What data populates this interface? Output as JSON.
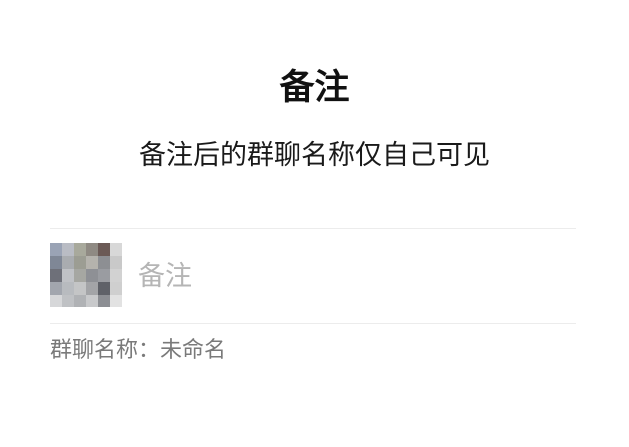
{
  "dialog": {
    "title": "备注",
    "subtitle": "备注后的群聊名称仅自己可见"
  },
  "remark_field": {
    "placeholder": "备注",
    "value": ""
  },
  "group_name": {
    "label": "群聊名称：",
    "value": "未命名"
  },
  "avatar": {
    "description_icon": "group-avatar-pixelated",
    "palette": [
      "#9aa3b5",
      "#b9bcc4",
      "#a8a99c",
      "#8f8a83",
      "#6b5a56",
      "#d8d8d8",
      "#7f8796",
      "#a9acb0",
      "#9c9d93",
      "#b5b3ad",
      "#8d8f93",
      "#c9c9c9",
      "#6e7079",
      "#c0c2c6",
      "#a6a7a2",
      "#8e9095",
      "#9a9ca1",
      "#d2d2d2",
      "#a2a6ae",
      "#b8bbbf",
      "#c4c5c6",
      "#a3a4a7",
      "#5f6168",
      "#cfcfcf",
      "#d6d7d9",
      "#bfc1c4",
      "#b0b2b5",
      "#c8c9cb",
      "#8c8e93",
      "#e2e2e2"
    ]
  }
}
